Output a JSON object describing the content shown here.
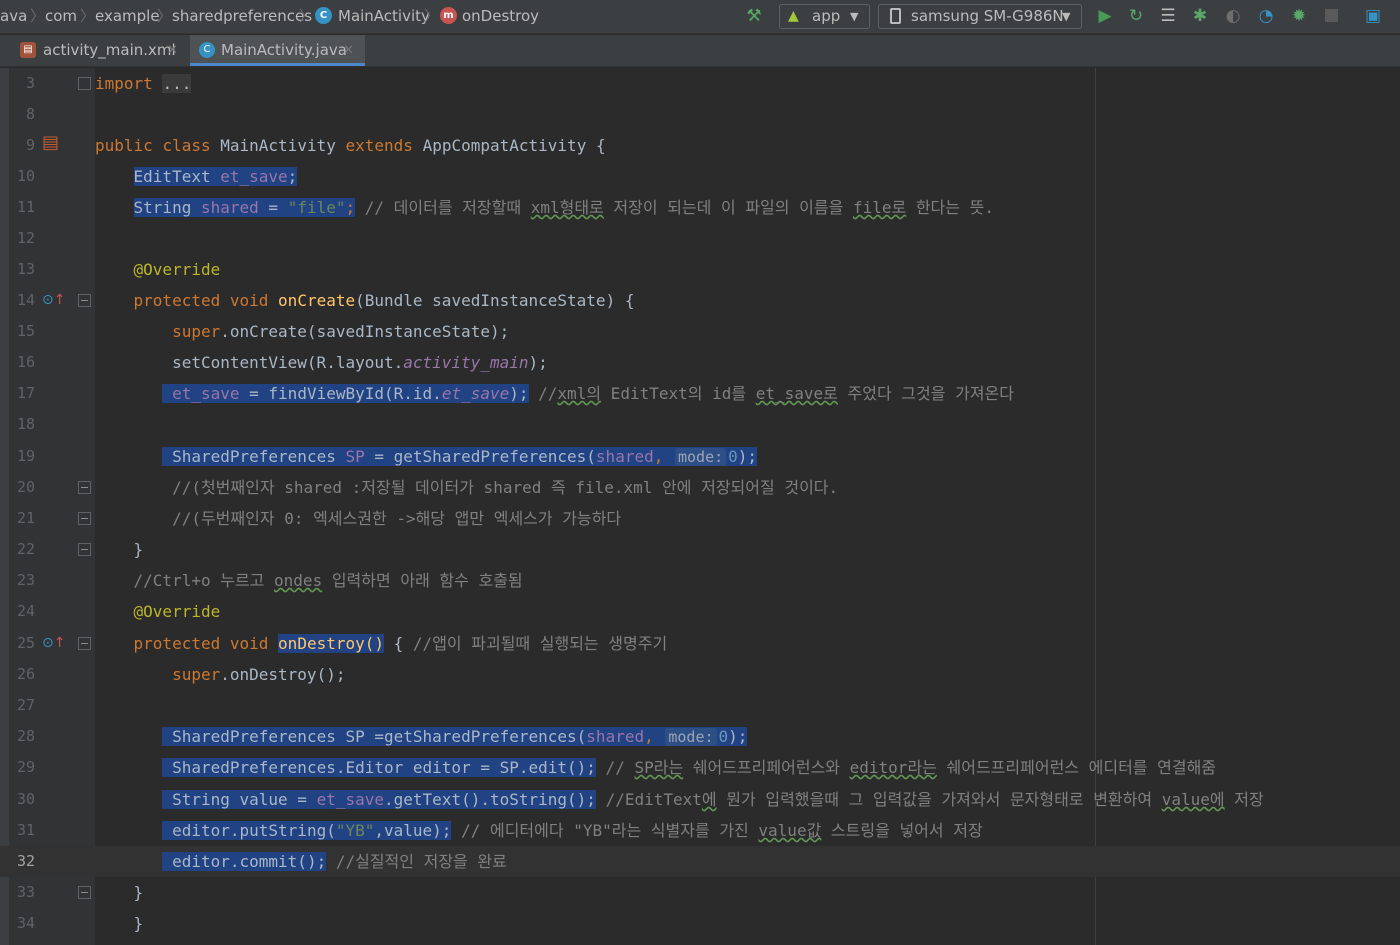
{
  "breadcrumbs": [
    "ava",
    "com",
    "example",
    "sharedpreferences",
    "MainActivity",
    "onDestroy"
  ],
  "toolbar": {
    "run_config": "app",
    "device": "samsung SM-G986N"
  },
  "tabs": [
    {
      "label": "activity_main.xml",
      "active": false
    },
    {
      "label": "MainActivity.java",
      "active": true
    }
  ],
  "line_numbers": [
    "3",
    "8",
    "9",
    "10",
    "11",
    "12",
    "13",
    "14",
    "15",
    "16",
    "17",
    "18",
    "19",
    "20",
    "21",
    "22",
    "23",
    "24",
    "25",
    "26",
    "27",
    "28",
    "29",
    "30",
    "31",
    "32",
    "33",
    "34"
  ],
  "current_line": "32",
  "code": {
    "l3_import": "import",
    "l3_folded": "...",
    "l9_public": "public",
    "l9_class": "class",
    "l9_name": "MainActivity",
    "l9_extends": "extends",
    "l9_super": "AppCompatActivity",
    "l9_brace": "{",
    "l10_type": "EditText",
    "l10_var": "et_save",
    "l11_type": "String",
    "l11_var": "shared",
    "l11_eq": "=",
    "l11_str": "\"file\"",
    "l11_c1": "// 데이터를 저장할때 ",
    "l11_c2": "xml형태로",
    "l11_c3": " 저장이 되는데 이 파일의 이름을 ",
    "l11_c4": "file로",
    "l11_c5": " 한다는 뜻.",
    "l13_ann": "@Override",
    "l14_mod": "protected",
    "l14_void": "void",
    "l14_fn": "onCreate",
    "l14_params": "(Bundle savedInstanceState) {",
    "l15_super": "super",
    "l15_rest": ".onCreate(savedInstanceState);",
    "l16_a": "setContentView(R.layout.",
    "l16_b": "activity_main",
    "l16_c": ");",
    "l17_var": "et_save",
    "l17_mid": " = findViewById(R.id.",
    "l17_id": "et_save",
    "l17_end": ");",
    "l17_c1": "//",
    "l17_c2": "xml의",
    "l17_c3": " EditText의 id를 ",
    "l17_c4": "et_save로",
    "l17_c5": " 주었다 그것을 가져온다",
    "l19_a": "SharedPreferences ",
    "l19_sp": "SP",
    "l19_b": " = getSharedPreferences(",
    "l19_shared": "shared",
    "l19_comma": ",",
    "l19_hint": "mode:",
    "l19_num": "0",
    "l19_end": ");",
    "l20_cm": "//(첫번째인자 shared :저장될 데이터가 shared 즉 file.xml 안에 저장되어질 것이다.",
    "l21_cm": "//(두번째인자 0: 엑세스권한 ->해당 앱만 엑세스가 가능하다",
    "l22_brace": "}",
    "l23_c1": "//Ctrl+o 누르고 ",
    "l23_c2": "ondes",
    "l23_c3": " 입력하면 아래 함수 호출됨",
    "l24_ann": "@Override",
    "l25_mod": "protected",
    "l25_void": "void",
    "l25_fn": "onDestroy()",
    "l25_brace": " { ",
    "l25_cm": "//앱이 파괴될때 실행되는 생명주기",
    "l26_super": "super",
    "l26_rest": ".onDestroy();",
    "l28_a": "SharedPreferences SP =getSharedPreferences(",
    "l28_shared": "shared",
    "l28_comma": ",",
    "l28_hint": "mode:",
    "l28_num": "0",
    "l28_end": ");",
    "l29_code": "SharedPreferences.Editor editor = SP.edit();",
    "l29_c1": " // ",
    "l29_c2": "SP라는",
    "l29_c3": " 쉐어드프리페어런스와 ",
    "l29_c4": "editor라는",
    "l29_c5": " 쉐어드프리페어런스 에디터를 연결해줌",
    "l30_a": "String value = ",
    "l30_var": "et_save",
    "l30_b": ".getText().toString();",
    "l30_c1": " //EditText",
    "l30_c2": "에",
    "l30_c3": " 뭔가 입력했을때 그 입력값을 가져와서 문자형태로 변환하여 ",
    "l30_c4": "value에",
    "l30_c5": " 저장",
    "l31_a": "editor.putString(",
    "l31_str": "\"YB\"",
    "l31_b": ",value);",
    "l31_c1": " // 에디터에다 \"YB\"라는 식별자를 가진 ",
    "l31_c2": "value값",
    "l31_c3": " 스트링을 넣어서 저장",
    "l32_a": "editor.commit();",
    "l32_c": " //실질적인 저장을 완료",
    "l33_brace": "}",
    "l34_brace": "}"
  },
  "icons": [
    "hammer-icon",
    "android-icon",
    "device-icon",
    "run-icon",
    "apply-changes-icon",
    "coverage-icon",
    "debug-icon",
    "attach-debugger-icon",
    "profiler-icon",
    "debug-bug-icon",
    "stop-icon",
    "project-structure-icon"
  ],
  "colors": {
    "keyword": "#cc7832",
    "field": "#9876aa",
    "string": "#6a8759",
    "number": "#6897bb",
    "annotation": "#bbb529",
    "method_decl": "#ffc66d",
    "comment": "#808080",
    "selection": "#214283",
    "run_green": "#499c54",
    "debug_green": "#59a869"
  }
}
